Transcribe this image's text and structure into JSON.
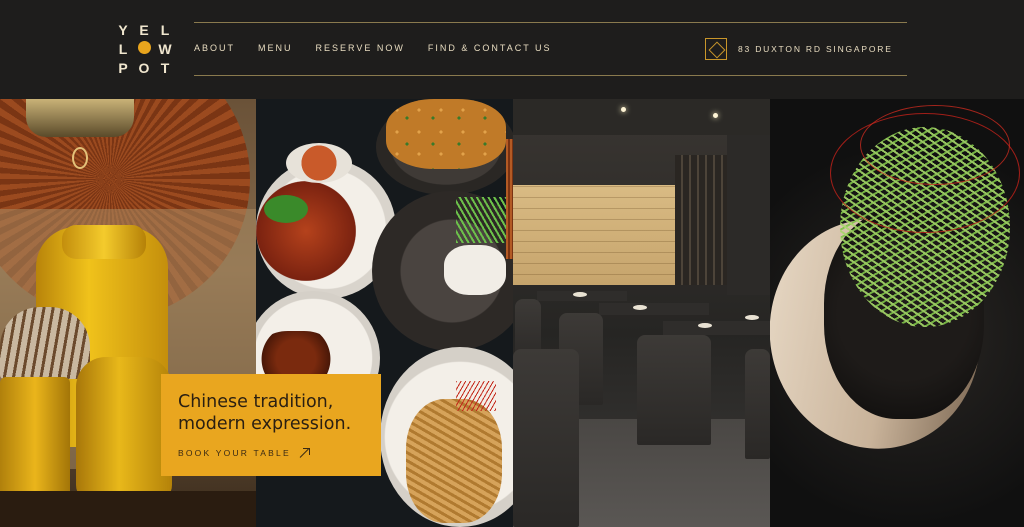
{
  "brand": {
    "logo_row1": [
      "Y",
      "E",
      "L"
    ],
    "logo_row2": [
      "L",
      "",
      "W"
    ],
    "logo_row3": [
      "P",
      "O",
      "T"
    ]
  },
  "nav": {
    "items": [
      {
        "label": "ABOUT"
      },
      {
        "label": "MENU"
      },
      {
        "label": "RESERVE NOW"
      },
      {
        "label": "FIND & CONTACT US"
      }
    ]
  },
  "address": {
    "text": "83 DUXTON RD SINGAPORE",
    "icon": "location-diamond-icon"
  },
  "hero": {
    "headline": "Chinese tradition, modern expression.",
    "cta_label": "BOOK YOUR TABLE",
    "cta_icon": "arrow-up-right-icon"
  },
  "colors": {
    "accent": "#e9a61f",
    "background": "#1e1d1c",
    "text": "#e8dcc0",
    "divider": "#8a7a4e"
  }
}
